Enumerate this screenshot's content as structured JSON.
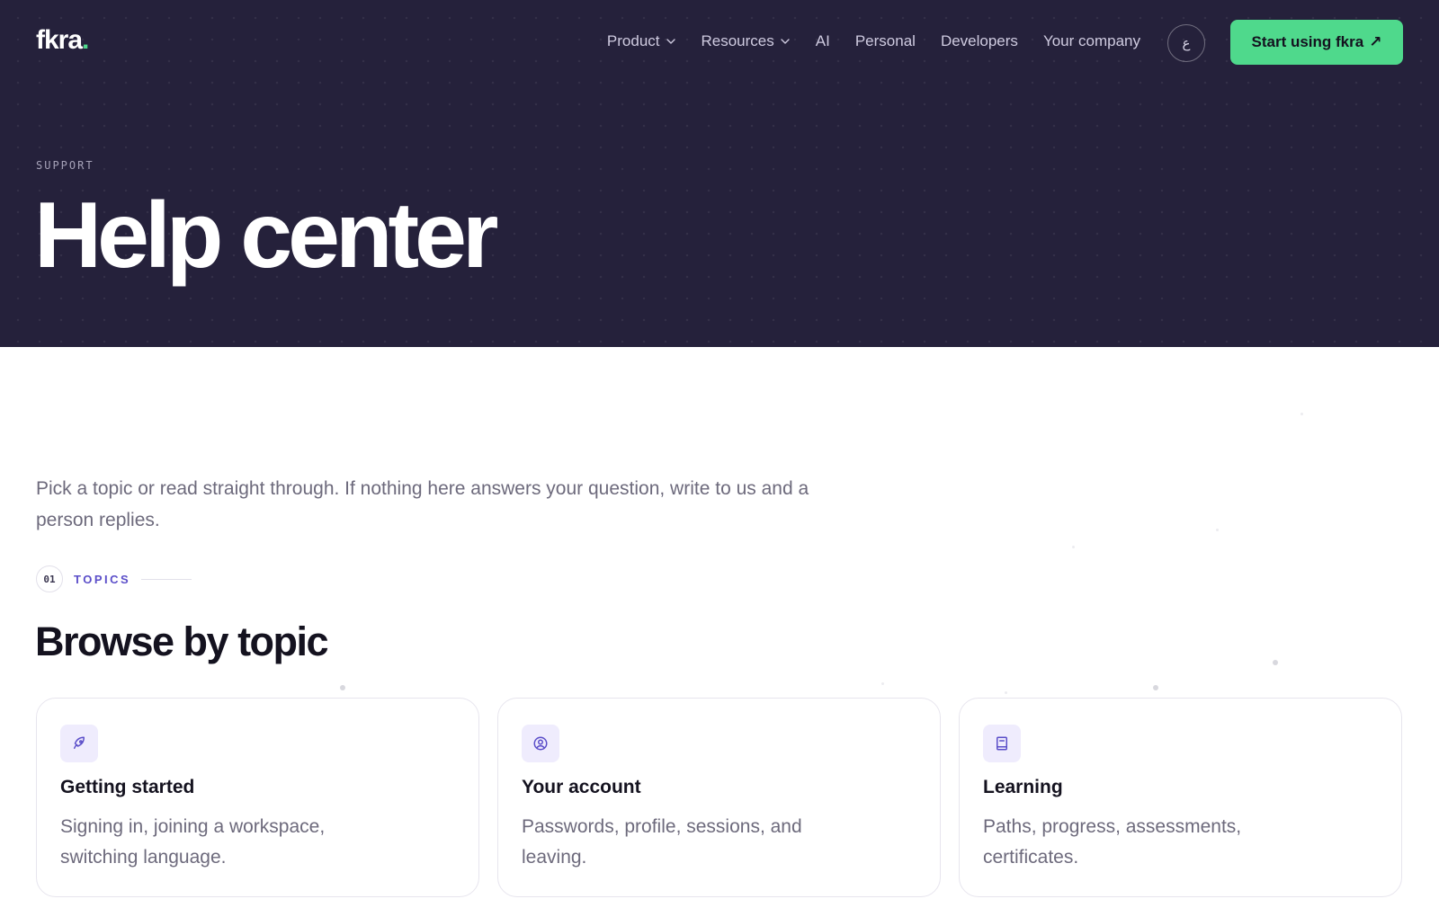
{
  "header": {
    "logo_text": "fkra",
    "logo_dot": ".",
    "nav": [
      {
        "label": "Product",
        "has_dropdown": true
      },
      {
        "label": "Resources",
        "has_dropdown": true
      },
      {
        "label": "AI",
        "has_dropdown": false
      },
      {
        "label": "Personal",
        "has_dropdown": false
      },
      {
        "label": "Developers",
        "has_dropdown": false
      },
      {
        "label": "Your company",
        "has_dropdown": false
      }
    ],
    "language_toggle": "ع",
    "cta_label": "Start using fkra",
    "cta_arrow": "↗"
  },
  "hero": {
    "eyebrow": "SUPPORT",
    "title": "Help center"
  },
  "main": {
    "intro": "Pick a topic or read straight through. If nothing here answers your question, write to us and a person replies.",
    "section": {
      "number": "01",
      "tag": "TOPICS",
      "title": "Browse by topic"
    },
    "topics": [
      {
        "icon": "rocket-icon",
        "title": "Getting started",
        "description": "Signing in, joining a workspace, switching language."
      },
      {
        "icon": "user-circle-icon",
        "title": "Your account",
        "description": "Passwords, profile, sessions, and leaving."
      },
      {
        "icon": "book-icon",
        "title": "Learning",
        "description": "Paths, progress, assessments, certificates."
      }
    ]
  },
  "colors": {
    "hero_bg": "#25213b",
    "accent_green": "#4fd98c",
    "accent_purple": "#5b4ec9",
    "icon_bg": "#efecfd"
  }
}
